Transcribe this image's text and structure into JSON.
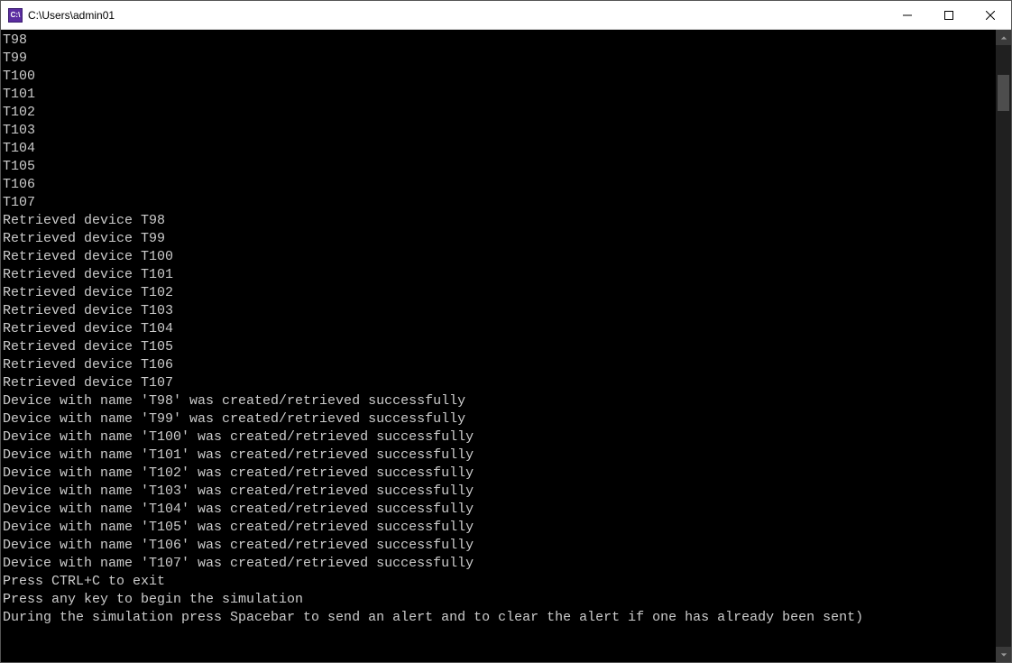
{
  "window": {
    "icon_text": "C:\\",
    "title": "C:\\Users\\admin01"
  },
  "console": {
    "lines": [
      "T98",
      "T99",
      "T100",
      "T101",
      "T102",
      "T103",
      "T104",
      "T105",
      "T106",
      "T107",
      "Retrieved device T98",
      "Retrieved device T99",
      "Retrieved device T100",
      "Retrieved device T101",
      "Retrieved device T102",
      "Retrieved device T103",
      "Retrieved device T104",
      "Retrieved device T105",
      "Retrieved device T106",
      "Retrieved device T107",
      "Device with name 'T98' was created/retrieved successfully",
      "Device with name 'T99' was created/retrieved successfully",
      "Device with name 'T100' was created/retrieved successfully",
      "Device with name 'T101' was created/retrieved successfully",
      "Device with name 'T102' was created/retrieved successfully",
      "Device with name 'T103' was created/retrieved successfully",
      "Device with name 'T104' was created/retrieved successfully",
      "Device with name 'T105' was created/retrieved successfully",
      "Device with name 'T106' was created/retrieved successfully",
      "Device with name 'T107' was created/retrieved successfully",
      "Press CTRL+C to exit",
      "Press any key to begin the simulation",
      "During the simulation press Spacebar to send an alert and to clear the alert if one has already been sent)"
    ]
  }
}
